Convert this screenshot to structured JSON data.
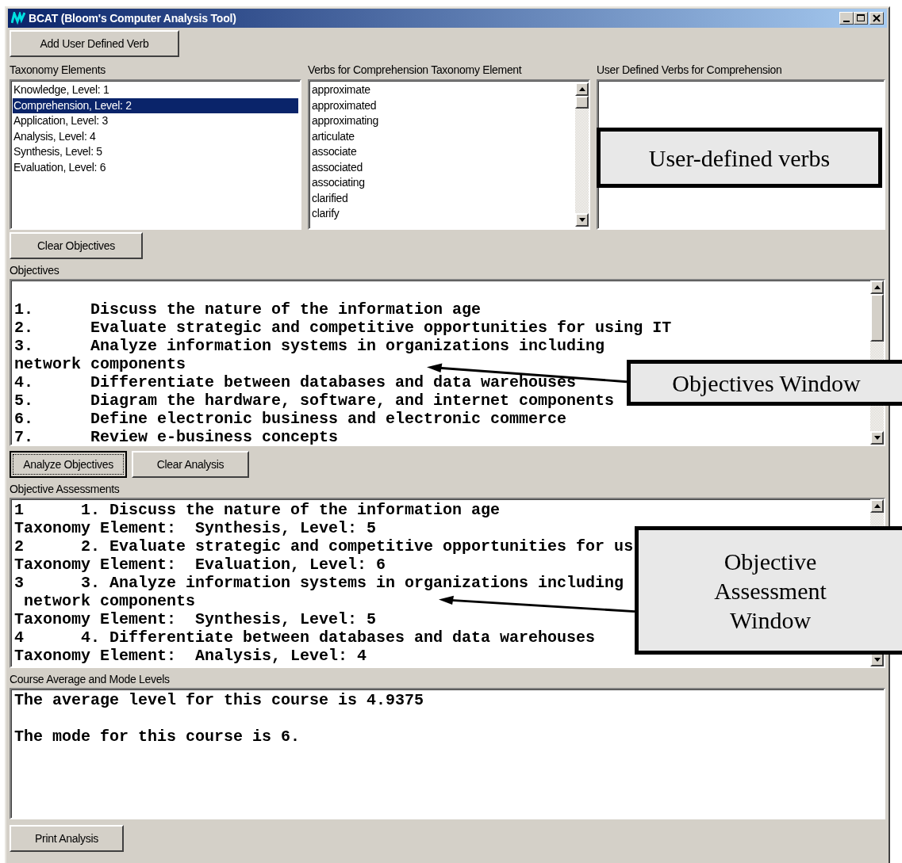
{
  "window": {
    "title": "BCAT (Bloom's Computer Analysis Tool)"
  },
  "add_verb_button": {
    "label": "Add User Defined Verb",
    "focused": false
  },
  "taxonomy": {
    "label": "Taxonomy Elements",
    "items": [
      {
        "text": "Knowledge, Level: 1",
        "selected": false
      },
      {
        "text": "Comprehension, Level: 2",
        "selected": true
      },
      {
        "text": "Application, Level: 3",
        "selected": false
      },
      {
        "text": "Analysis, Level: 4",
        "selected": false
      },
      {
        "text": "Synthesis, Level: 5",
        "selected": false
      },
      {
        "text": "Evaluation, Level: 6",
        "selected": false
      }
    ]
  },
  "verbs": {
    "label": "Verbs for Comprehension Taxonomy Element",
    "items": [
      "approximate",
      "approximated",
      "approximating",
      "articulate",
      "associate",
      "associated",
      "associating",
      "clarified",
      "clarify"
    ]
  },
  "user_verbs": {
    "label": "User Defined Verbs for Comprehension"
  },
  "clear_objectives_button": {
    "label": "Clear Objectives",
    "focused": false
  },
  "objectives": {
    "label": "Objectives",
    "lines": [
      "1.      Discuss the nature of the information age",
      "2.      Evaluate strategic and competitive opportunities for using IT",
      "3.      Analyze information systems in organizations including",
      "network components",
      "4.      Differentiate between databases and data warehouses",
      "5.      Diagram the hardware, software, and internet components",
      "6.      Define electronic business and electronic commerce",
      "7.      Review e-business concepts"
    ]
  },
  "analysis_buttons": [
    {
      "label": "Analyze Objectives",
      "focused": true
    },
    {
      "label": "Clear Analysis",
      "focused": false
    }
  ],
  "assessments": {
    "label": "Objective Assessments",
    "lines": [
      "1      1. Discuss the nature of the information age",
      "Taxonomy Element:  Synthesis, Level: 5",
      "2      2. Evaluate strategic and competitive opportunities for us",
      "Taxonomy Element:  Evaluation, Level: 6",
      "3      3. Analyze information systems in organizations including",
      " network components",
      "Taxonomy Element:  Synthesis, Level: 5",
      "4      4. Differentiate between databases and data warehouses",
      "Taxonomy Element:  Analysis, Level: 4"
    ]
  },
  "course": {
    "label": "Course Average and Mode Levels",
    "lines": [
      "The average level for this course is 4.9375",
      "The mode for this course is 6."
    ]
  },
  "print_button": {
    "label": "Print Analysis",
    "focused": false
  },
  "callouts": [
    {
      "kind": "box",
      "text": "User-defined verbs"
    },
    {
      "kind": "arrow",
      "text": "Objectives Window"
    },
    {
      "kind": "arrow",
      "text": "Objective Assessment Window"
    }
  ]
}
